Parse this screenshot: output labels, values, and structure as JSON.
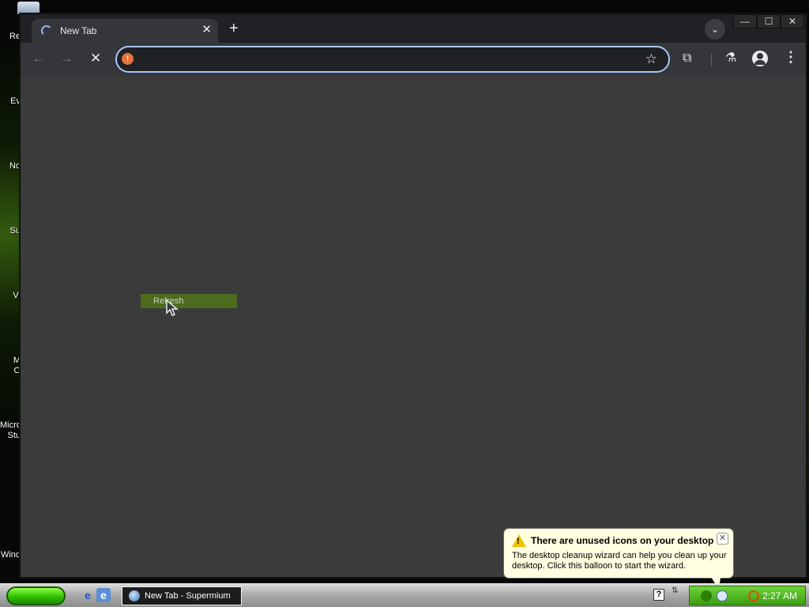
{
  "desktop": {
    "icon_labels": [
      "Re",
      "Ev",
      "No",
      "Su",
      "Vi",
      "M",
      "O",
      "Micro",
      "Stu",
      "Wind"
    ]
  },
  "browser": {
    "tab": {
      "title": "New Tab",
      "close_glyph": "✕"
    },
    "new_tab_glyph": "+",
    "tab_search_glyph": "⌄",
    "window_buttons": {
      "minimize": "—",
      "maximize": "☐",
      "close": "✕"
    },
    "toolbar": {
      "back_glyph": "←",
      "forward_glyph": "→",
      "stop_glyph": "✕",
      "omnibox": {
        "value": "",
        "placeholder": ""
      },
      "star_glyph": "☆",
      "extensions_glyph": "⧉",
      "labs_glyph": "⚗",
      "menu_glyph": "⋮"
    },
    "context_item": "Refresh"
  },
  "balloon": {
    "title": "There are unused icons on your desktop",
    "message": "The desktop cleanup wizard can help you clean up your desktop. Click this balloon to start the wizard.",
    "close_glyph": "✕",
    "warn_glyph": "!"
  },
  "taskbar": {
    "task_button": "New Tab - Supermium",
    "help_glyph": "?",
    "clock": "2:27 AM",
    "ie_glyph": "e",
    "ql2_glyph": "e"
  },
  "colors": {
    "accent": "#a8c7fa",
    "browser_bg": "#3b3b3b",
    "tray_green": "#4fb020"
  }
}
